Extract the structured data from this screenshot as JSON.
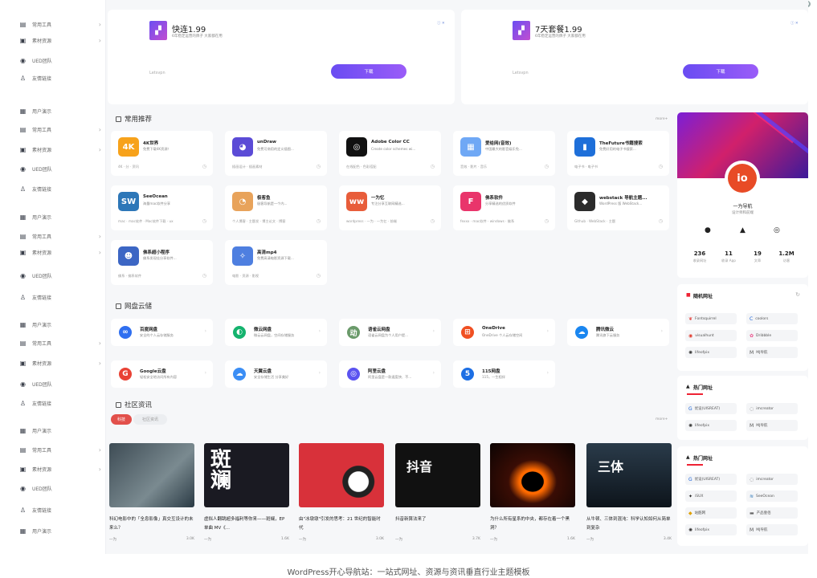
{
  "window_controls": [
    "minimize-icon",
    "maximize-icon",
    "help-icon"
  ],
  "sidebar": {
    "items": [
      {
        "label": "常用工具",
        "icon": "toolbox-icon",
        "chevron": true
      },
      {
        "label": "素材资源",
        "icon": "briefcase-icon",
        "chevron": true
      },
      {
        "label": "UED团队",
        "icon": "globe-icon",
        "chevron": false
      },
      {
        "label": "友情链接",
        "icon": "people-icon",
        "chevron": false
      },
      {
        "label": "用户演示",
        "icon": "monitor-icon",
        "chevron": false
      },
      {
        "label": "常用工具",
        "icon": "toolbox-icon",
        "chevron": true
      },
      {
        "label": "素材资源",
        "icon": "briefcase-icon",
        "chevron": true
      },
      {
        "label": "UED团队",
        "icon": "globe-icon",
        "chevron": false
      },
      {
        "label": "友情链接",
        "icon": "people-icon",
        "chevron": false
      },
      {
        "label": "用户演示",
        "icon": "monitor-icon",
        "chevron": false
      },
      {
        "label": "常用工具",
        "icon": "toolbox-icon",
        "chevron": true
      },
      {
        "label": "素材资源",
        "icon": "briefcase-icon",
        "chevron": true
      },
      {
        "label": "UED团队",
        "icon": "globe-icon",
        "chevron": false
      },
      {
        "label": "友情链接",
        "icon": "people-icon",
        "chevron": false
      },
      {
        "label": "用户演示",
        "icon": "monitor-icon",
        "chevron": false
      },
      {
        "label": "常用工具",
        "icon": "toolbox-icon",
        "chevron": true
      },
      {
        "label": "素材资源",
        "icon": "briefcase-icon",
        "chevron": true
      },
      {
        "label": "UED团队",
        "icon": "globe-icon",
        "chevron": false
      },
      {
        "label": "友情链接",
        "icon": "people-icon",
        "chevron": false
      },
      {
        "label": "用户演示",
        "icon": "monitor-icon",
        "chevron": false
      },
      {
        "label": "常用工具",
        "icon": "toolbox-icon",
        "chevron": true
      },
      {
        "label": "素材资源",
        "icon": "briefcase-icon",
        "chevron": true
      },
      {
        "label": "UED团队",
        "icon": "globe-icon",
        "chevron": false
      },
      {
        "label": "友情链接",
        "icon": "people-icon",
        "chevron": false
      },
      {
        "label": "用户演示",
        "icon": "monitor-icon",
        "chevron": false
      }
    ]
  },
  "ads": [
    {
      "title": "快连1.99",
      "desc": "6年稳定运营的牌子 大家都在用",
      "brand": "Letsvpn",
      "button": "下载",
      "mark": "ⓘ ✕"
    },
    {
      "title": "7天套餐1.99",
      "desc": "6年稳定运营的牌子 大家都在用",
      "brand": "Letsvpn",
      "button": "下载",
      "mark": "ⓘ ✕"
    }
  ],
  "common": {
    "title": "常用推荐",
    "more": "more+",
    "cards": [
      {
        "name": "4K世界",
        "desc": "免费下载4K资源！",
        "tags": "4K · 分 · 资讯",
        "icon_text": "4K",
        "color": "#f7a21b"
      },
      {
        "name": "unDraw",
        "desc": "免费可商用的定义插图...",
        "tags": "插画设计 · 插画素材",
        "icon_text": "◕",
        "color": "#5b4bd6"
      },
      {
        "name": "Adobe Color CC",
        "desc": "Create color schemes wi...",
        "tags": "在线配色 · 色彩搭配",
        "icon_text": "◎",
        "color": "#111111"
      },
      {
        "name": "爱给网(音效)",
        "desc": "中国最大的影音娱乐免...",
        "tags": "音效 · 影片 · 音乐",
        "icon_text": "▦",
        "color": "#6fa8f5"
      },
      {
        "name": "TheFuture书籍搜索",
        "desc": "免费好用的电子书搜索...",
        "tags": "电子书 · 电子书",
        "icon_text": "▮",
        "color": "#1e6fd9"
      },
      {
        "name": "SeeOcean",
        "desc": "海量mac软件分享",
        "tags": "mac · mac软件 · Mac软件下载 · ux",
        "icon_text": "SW",
        "color": "#2d77b8"
      },
      {
        "name": "极客鱼",
        "desc": "极客导航是一个内...",
        "tags": "个人博客 · 主题发 · 博主论文 · 博客",
        "icon_text": "◔",
        "color": "#e8a35b"
      },
      {
        "name": "一为忆",
        "desc": "专注分享互联网精选...",
        "tags": "wordpress · 一为 · 一为忆 · 前端",
        "icon_text": "ww",
        "color": "#e85d3a"
      },
      {
        "name": "佛系软件",
        "desc": "分享精选的优质软件",
        "tags": "fexxx · mac软件 · windows · 佛系",
        "icon_text": "F",
        "color": "#e9356b"
      },
      {
        "name": "webstack 导航主题...",
        "desc": "WordPress 版 WebStack...",
        "tags": "Github · WebStack · 主题",
        "icon_text": "◆",
        "color": "#2b2b2b"
      },
      {
        "name": "佛系超小程序",
        "desc": "佛系发现佳分享软件...",
        "tags": "佛系 · 佛系软件",
        "icon_text": "☻",
        "color": "#3c66c4"
      },
      {
        "name": "高清mp4",
        "desc": "免费高清电影资源下载...",
        "tags": "电影 · 资源 · 影视",
        "icon_text": "✧",
        "color": "#4e7fe0"
      }
    ]
  },
  "cloud": {
    "title": "网盘云储",
    "cards": [
      {
        "name": "百度网盘",
        "desc": "安全的个人云存储服务",
        "icon_text": "∞",
        "color": "#2f6ff0"
      },
      {
        "name": "微云网盘",
        "desc": "微云云网盘，空间存储服务",
        "icon_text": "◐",
        "color": "#15b36e"
      },
      {
        "name": "语雀云网盘",
        "desc": "语雀云网盘为个人用户提...",
        "icon_text": "动",
        "color": "#6a9a6a"
      },
      {
        "name": "OneDrive",
        "desc": "OneDrive 个人云存储空间",
        "icon_text": "⊞",
        "color": "#f05022"
      },
      {
        "name": "腾讯微云",
        "desc": "腾讯旗下云服务",
        "icon_text": "☁",
        "color": "#1a86f0"
      },
      {
        "name": "Google云盘",
        "desc": "轻松安全地访问所有内容",
        "icon_text": "G",
        "color": "#e94235"
      },
      {
        "name": "天翼云盘",
        "desc": "安全存储生活 分享美好",
        "icon_text": "☁",
        "color": "#3b8ef5"
      },
      {
        "name": "阿里云盘",
        "desc": "阿里云盘是一款速度快、不...",
        "icon_text": "◎",
        "color": "#5b53f0"
      },
      {
        "name": "115网盘",
        "desc": "115，一生相伴",
        "icon_text": "5",
        "color": "#1d6fe4"
      }
    ]
  },
  "community": {
    "title": "社区资讯",
    "more": "more+",
    "tabs": [
      "科技",
      "社区资讯"
    ],
    "news": [
      {
        "title": "科幻电影中的「全息影像」真交互设计的未来么？",
        "author": "一为",
        "views": "3.0K",
        "thumb_text": "",
        "thumb_color": "#5a6b73"
      },
      {
        "title": "虚拟人翻跳超多福利等你来——斑斓，EP 单曲 MV《...",
        "author": "一为",
        "views": "1.6K",
        "thumb_text": "斑斓",
        "thumb_color": "#1a1a22"
      },
      {
        "title": "由\"冰墩墩\"引发的思考：21 世纪的智能时代",
        "author": "一为",
        "views": "3.0K",
        "thumb_text": "",
        "thumb_color": "#d8313a"
      },
      {
        "title": "抖音新算法来了",
        "author": "一为",
        "views": "3.7K",
        "thumb_text": "抖音",
        "thumb_color": "#111111"
      },
      {
        "title": "为什么所有星系的中央，都存在着一个黑洞？",
        "author": "一为",
        "views": "1.6K",
        "thumb_text": "",
        "thumb_color": "#1b0a05"
      },
      {
        "title": "从牛顿、三体到混沌：科学认知如何从简单到复杂",
        "author": "一为",
        "views": "3.4K",
        "thumb_text": "三体",
        "thumb_color": "#182430"
      }
    ]
  },
  "profile": {
    "name": "一为导航",
    "subtitle": "设计师和前端",
    "avatar_text": "io",
    "stats": [
      {
        "value": "236",
        "label": "收录网址"
      },
      {
        "value": "11",
        "label": "收录 App"
      },
      {
        "value": "19",
        "label": "文章"
      },
      {
        "value": "1.2M",
        "label": "访客"
      }
    ]
  },
  "random": {
    "title": "随机网址",
    "items": [
      {
        "label": "Fontsquirrel",
        "icon": "squirrel-icon",
        "color": "#e2403a"
      },
      {
        "label": "coolors",
        "icon": "c-icon",
        "color": "#1a63d8"
      },
      {
        "label": "visualhunt",
        "icon": "v-icon",
        "color": "#e03b2d"
      },
      {
        "label": "Dribbble",
        "icon": "ball-icon",
        "color": "#ea4c89"
      },
      {
        "label": "lifeofpix",
        "icon": "pix-icon",
        "color": "#333333"
      },
      {
        "label": "MJ导航",
        "icon": "mj-icon",
        "color": "#555555"
      }
    ]
  },
  "hot1": {
    "title": "热门网址",
    "items": [
      {
        "label": "优设(UISREAT)",
        "icon": "g-icon",
        "color": "#1a63d8"
      },
      {
        "label": "imcreator",
        "icon": "spin-icon",
        "color": "#777777"
      },
      {
        "label": "lifeofpix",
        "icon": "pix-icon",
        "color": "#333333"
      },
      {
        "label": "MJ导航",
        "icon": "mj-icon",
        "color": "#555555"
      }
    ]
  },
  "hot2": {
    "title": "热门网址",
    "items": [
      {
        "label": "优设(UISREAT)",
        "icon": "g-icon",
        "color": "#1a63d8"
      },
      {
        "label": "imcreator",
        "icon": "spin-icon",
        "color": "#777777"
      },
      {
        "label": "iSUX",
        "icon": "isux-icon",
        "color": "#222222"
      },
      {
        "label": "SeeOcean",
        "icon": "sw-icon",
        "color": "#2d77b8"
      },
      {
        "label": "站酷网",
        "icon": "zcool-icon",
        "color": "#e0a000"
      },
      {
        "label": "产品壹佰",
        "icon": "pm-icon",
        "color": "#666666"
      },
      {
        "label": "lifeofpix",
        "icon": "pix-icon",
        "color": "#333333"
      },
      {
        "label": "MJ导航",
        "icon": "mj-icon",
        "color": "#555555"
      }
    ]
  },
  "caption": "WordPress开心导航站：一站式网址、资源与资讯垂直行业主题模板"
}
